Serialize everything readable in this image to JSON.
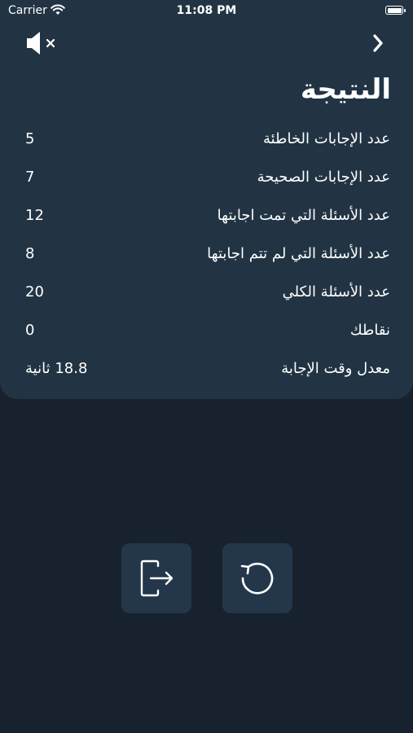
{
  "status_bar": {
    "carrier": "Carrier",
    "time": "11:08 PM",
    "battery_level": 1.0
  },
  "header": {
    "sound_icon": "speaker-muted-icon",
    "next_icon": "chevron-right-icon"
  },
  "result": {
    "title": "النتيجة",
    "stats": [
      {
        "label": "عدد الإجابات الخاطئة",
        "value": "5"
      },
      {
        "label": "عدد الإجابات الصحيحة",
        "value": "7"
      },
      {
        "label": "عدد الأسئلة التي تمت اجابتها",
        "value": "12"
      },
      {
        "label": "عدد الأسئلة التي لم تتم اجابتها",
        "value": "8"
      },
      {
        "label": "عدد الأسئلة الكلي",
        "value": "20"
      },
      {
        "label": "نقاطك",
        "value": "0"
      },
      {
        "label": "معدل وقت الإجابة",
        "value": "18.8 ثانية"
      }
    ]
  },
  "actions": {
    "exit_icon": "exit-icon",
    "restart_icon": "restart-icon"
  },
  "colors": {
    "background": "#17222e",
    "card": "#223444",
    "button": "#24364a",
    "text": "#ffffff"
  }
}
